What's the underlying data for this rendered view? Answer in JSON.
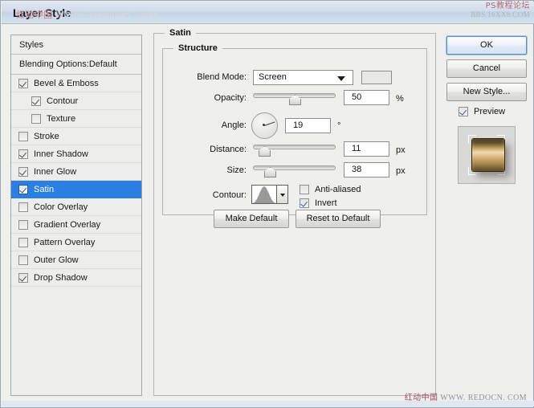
{
  "window": {
    "title": "Layer Style"
  },
  "watermarks": {
    "title_overlay_cn": "红动中国",
    "title_overlay_url": "WWW. REDOCN. COM",
    "top_right_line1": "PS教程论坛",
    "top_right_line2": "BBS.16XX8.COM",
    "bottom_right_cn": "红动中国",
    "bottom_right_url": "WWW. REDOCN. COM"
  },
  "styles_panel": {
    "header": "Styles",
    "blending_options": "Blending Options:Default",
    "items": [
      {
        "label": "Bevel & Emboss",
        "checked": true,
        "sub": false,
        "selected": false
      },
      {
        "label": "Contour",
        "checked": true,
        "sub": true,
        "selected": false
      },
      {
        "label": "Texture",
        "checked": false,
        "sub": true,
        "selected": false
      },
      {
        "label": "Stroke",
        "checked": false,
        "sub": false,
        "selected": false
      },
      {
        "label": "Inner Shadow",
        "checked": true,
        "sub": false,
        "selected": false
      },
      {
        "label": "Inner Glow",
        "checked": true,
        "sub": false,
        "selected": false
      },
      {
        "label": "Satin",
        "checked": true,
        "sub": false,
        "selected": true
      },
      {
        "label": "Color Overlay",
        "checked": false,
        "sub": false,
        "selected": false
      },
      {
        "label": "Gradient Overlay",
        "checked": false,
        "sub": false,
        "selected": false
      },
      {
        "label": "Pattern Overlay",
        "checked": false,
        "sub": false,
        "selected": false
      },
      {
        "label": "Outer Glow",
        "checked": false,
        "sub": false,
        "selected": false
      },
      {
        "label": "Drop Shadow",
        "checked": true,
        "sub": false,
        "selected": false
      }
    ]
  },
  "satin": {
    "group_title": "Satin",
    "structure_title": "Structure",
    "blend_mode": {
      "label": "Blend Mode:",
      "value": "Screen",
      "swatch_color": "#e8e8e6"
    },
    "opacity": {
      "label": "Opacity:",
      "value": "50",
      "unit": "%",
      "slider_percent": 50
    },
    "angle": {
      "label": "Angle:",
      "value": "19",
      "unit": "°",
      "degrees": 19
    },
    "distance": {
      "label": "Distance:",
      "value": "11",
      "unit": "px",
      "slider_percent": 8
    },
    "size": {
      "label": "Size:",
      "value": "38",
      "unit": "px",
      "slider_percent": 16
    },
    "contour": {
      "label": "Contour:"
    },
    "anti_aliased": {
      "label": "Anti-aliased",
      "checked": false
    },
    "invert": {
      "label": "Invert",
      "checked": true
    },
    "make_default_button": "Make Default",
    "reset_to_default_button": "Reset to Default"
  },
  "actions": {
    "ok": "OK",
    "cancel": "Cancel",
    "new_style": "New Style...",
    "preview_label": "Preview",
    "preview_checked": true
  }
}
